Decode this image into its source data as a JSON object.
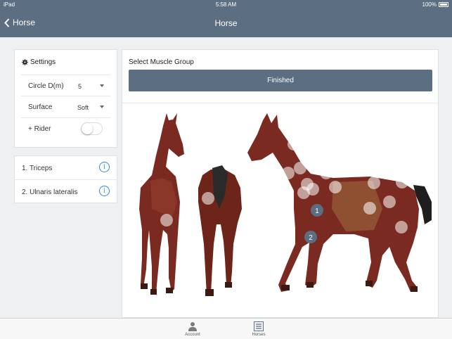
{
  "status_bar": {
    "device": "iPad",
    "time": "5:58 AM",
    "battery": "100%"
  },
  "nav": {
    "back_label": "Horse",
    "title": "Horse"
  },
  "settings": {
    "title": "Settings",
    "circle_label": "Circle D(m)",
    "circle_value": "5",
    "surface_label": "Surface",
    "surface_value": "Soft",
    "rider_label": "+ Rider",
    "rider_on": false
  },
  "muscles": [
    {
      "label": "1. Triceps"
    },
    {
      "label": "2. Ulnaris lateralis"
    }
  ],
  "main": {
    "heading": "Select Muscle Group",
    "finish_label": "Finished"
  },
  "markers": [
    "1",
    "2"
  ],
  "tabs": [
    {
      "label": "Account",
      "icon": "person-icon"
    },
    {
      "label": "Horses",
      "icon": "list-icon"
    }
  ],
  "colors": {
    "accent": "#5b6e82",
    "info": "#2b8ce0"
  }
}
